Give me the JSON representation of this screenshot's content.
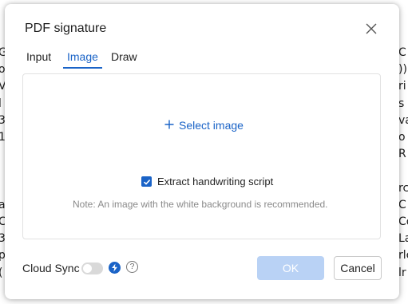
{
  "background": {
    "left_fragments": [
      "G",
      "o",
      "V",
      "l",
      "3",
      "1",
      "",
      "",
      "a",
      "C",
      "3",
      "p",
      "(",
      "",
      ""
    ],
    "right_fragments": [
      "C",
      ")) ",
      "ri",
      "s",
      "va",
      "o",
      "R",
      "",
      "rc",
      "C",
      "Co",
      "La",
      "rle",
      "lr",
      ""
    ]
  },
  "dialog": {
    "title": "PDF signature",
    "tabs": [
      {
        "label": "Input",
        "active": false
      },
      {
        "label": "Image",
        "active": true
      },
      {
        "label": "Draw",
        "active": false
      }
    ],
    "select_image_label": "Select image",
    "extract_label": "Extract handwriting script",
    "extract_checked": true,
    "note": "Note: An image with the white background is recommended.",
    "cloud_sync_label": "Cloud Sync",
    "cloud_sync_enabled": false,
    "help_glyph": "?",
    "ok_label": "OK",
    "cancel_label": "Cancel"
  },
  "colors": {
    "accent": "#1a63c7",
    "ok_disabled": "#b9d2f5"
  }
}
